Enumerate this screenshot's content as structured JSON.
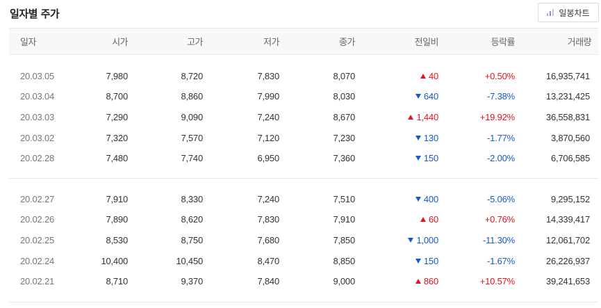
{
  "title": "일자별 주가",
  "chart_button": {
    "label": "일봉차트",
    "icon": "bar-chart-icon"
  },
  "colors": {
    "up": "#e4151e",
    "down": "#1759c6"
  },
  "columns": [
    "일자",
    "시가",
    "고가",
    "저가",
    "종가",
    "전일비",
    "등락률",
    "거래량"
  ],
  "groups": [
    [
      {
        "date": "20.03.05",
        "open": "7,980",
        "high": "8,720",
        "low": "7,830",
        "close": "8,070",
        "dir": "up",
        "change": "40",
        "rate": "+0.50%",
        "volume": "16,935,741"
      },
      {
        "date": "20.03.04",
        "open": "8,700",
        "high": "8,860",
        "low": "7,990",
        "close": "8,030",
        "dir": "down",
        "change": "640",
        "rate": "-7.38%",
        "volume": "13,231,425"
      },
      {
        "date": "20.03.03",
        "open": "7,290",
        "high": "9,090",
        "low": "7,240",
        "close": "8,670",
        "dir": "up",
        "change": "1,440",
        "rate": "+19.92%",
        "volume": "36,558,831"
      },
      {
        "date": "20.03.02",
        "open": "7,320",
        "high": "7,570",
        "low": "7,120",
        "close": "7,230",
        "dir": "down",
        "change": "130",
        "rate": "-1.77%",
        "volume": "3,870,560"
      },
      {
        "date": "20.02.28",
        "open": "7,480",
        "high": "7,740",
        "low": "6,950",
        "close": "7,360",
        "dir": "down",
        "change": "150",
        "rate": "-2.00%",
        "volume": "6,706,585"
      }
    ],
    [
      {
        "date": "20.02.27",
        "open": "7,910",
        "high": "8,330",
        "low": "7,240",
        "close": "7,510",
        "dir": "down",
        "change": "400",
        "rate": "-5.06%",
        "volume": "9,295,152"
      },
      {
        "date": "20.02.26",
        "open": "7,890",
        "high": "8,620",
        "low": "7,830",
        "close": "7,910",
        "dir": "up",
        "change": "60",
        "rate": "+0.76%",
        "volume": "14,339,417"
      },
      {
        "date": "20.02.25",
        "open": "8,530",
        "high": "8,750",
        "low": "7,680",
        "close": "7,850",
        "dir": "down",
        "change": "1,000",
        "rate": "-11.30%",
        "volume": "12,061,702"
      },
      {
        "date": "20.02.24",
        "open": "10,400",
        "high": "10,450",
        "low": "8,470",
        "close": "8,850",
        "dir": "down",
        "change": "150",
        "rate": "-1.67%",
        "volume": "26,226,937"
      },
      {
        "date": "20.02.21",
        "open": "8,710",
        "high": "9,370",
        "low": "7,840",
        "close": "9,000",
        "dir": "up",
        "change": "860",
        "rate": "+10.57%",
        "volume": "39,241,653"
      }
    ]
  ]
}
